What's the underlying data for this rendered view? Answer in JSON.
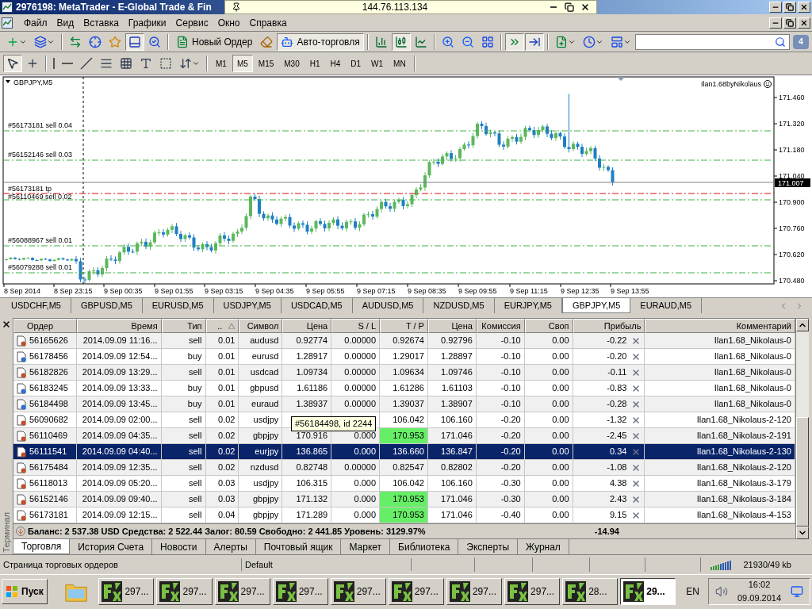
{
  "window": {
    "title": "2976198: MetaTrader - E-Global Trade & Fin"
  },
  "remote_bar": {
    "address": "144.76.113.134"
  },
  "menu": [
    "Файл",
    "Вид",
    "Вставка",
    "Графики",
    "Сервис",
    "Окно",
    "Справка"
  ],
  "toolbar": {
    "items": [
      {
        "kind": "new-chart",
        "pressed": false
      },
      {
        "kind": "profiles",
        "pressed": false
      },
      {
        "kind": "separator"
      },
      {
        "kind": "market-watch",
        "pressed": false
      },
      {
        "kind": "navigator",
        "pressed": false
      },
      {
        "kind": "favorites",
        "pressed": false
      },
      {
        "kind": "terminal",
        "pressed": true
      },
      {
        "kind": "tester",
        "pressed": false
      },
      {
        "kind": "separator"
      },
      {
        "kind": "order",
        "label": "Новый Ордер",
        "pressed": false
      },
      {
        "kind": "editor",
        "pressed": false
      },
      {
        "kind": "autotrading",
        "label": "Авто-торговля",
        "pressed": true
      },
      {
        "kind": "separator"
      },
      {
        "kind": "bar-chart",
        "pressed": false
      },
      {
        "kind": "candles",
        "pressed": true
      },
      {
        "kind": "line-chart",
        "pressed": false
      },
      {
        "kind": "separator"
      },
      {
        "kind": "zoom-in",
        "pressed": false
      },
      {
        "kind": "zoom-out",
        "pressed": false
      },
      {
        "kind": "tile",
        "pressed": false
      },
      {
        "kind": "separator"
      },
      {
        "kind": "autoscroll",
        "pressed": true
      },
      {
        "kind": "chart-shift",
        "pressed": true
      },
      {
        "kind": "separator"
      },
      {
        "kind": "indicators",
        "pressed": false
      },
      {
        "kind": "periods",
        "pressed": false
      },
      {
        "kind": "templates",
        "pressed": false
      }
    ],
    "messages": "4"
  },
  "tools": [
    {
      "kind": "cursor",
      "pressed": true
    },
    {
      "kind": "crosshair",
      "pressed": false
    },
    {
      "kind": "separator"
    },
    {
      "kind": "vline",
      "pressed": false
    },
    {
      "kind": "hline",
      "pressed": false
    },
    {
      "kind": "trend",
      "pressed": false
    },
    {
      "kind": "fibo",
      "pressed": false
    },
    {
      "kind": "gann",
      "pressed": false
    },
    {
      "kind": "text",
      "pressed": false
    },
    {
      "kind": "label",
      "pressed": false
    },
    {
      "kind": "arrows",
      "pressed": false
    }
  ],
  "timeframes": [
    {
      "label": "M1",
      "selected": false
    },
    {
      "label": "M5",
      "selected": true
    },
    {
      "label": "M15",
      "selected": false
    },
    {
      "label": "M30",
      "selected": false
    },
    {
      "label": "H1",
      "selected": false
    },
    {
      "label": "H4",
      "selected": false
    },
    {
      "label": "D1",
      "selected": false
    },
    {
      "label": "W1",
      "selected": false
    },
    {
      "label": "MN",
      "selected": false
    }
  ],
  "chart": {
    "title": "GBPJPY,M5",
    "expert": "Ilan1.68byNikolaus",
    "current_price": "171.007",
    "price_ticks": [
      "171.460",
      "171.320",
      "171.180",
      "171.040",
      "170.900",
      "170.760",
      "170.620",
      "170.480"
    ],
    "time_labels": [
      "8 Sep 2014",
      "8 Sep 23:15",
      "9 Sep 00:35",
      "9 Sep 01:55",
      "9 Sep 03:15",
      "9 Sep 04:35",
      "9 Sep 05:55",
      "9 Sep 07:15",
      "9 Sep 08:35",
      "9 Sep 09:55",
      "9 Sep 11:15",
      "9 Sep 12:35",
      "9 Sep 13:55"
    ],
    "order_lines": [
      {
        "label": "#56173181 sell 0.04",
        "kind": "order"
      },
      {
        "label": "#56152146 sell 0.03",
        "kind": "order"
      },
      {
        "label": "#56173181 tp",
        "kind": "tp"
      },
      {
        "label": "#56110469 sell 0.02",
        "kind": "order"
      },
      {
        "label": "#56088967 sell 0.01",
        "kind": "order"
      },
      {
        "label": "#56079288 sell 0.01",
        "kind": "order"
      }
    ]
  },
  "symbol_tabs": [
    {
      "label": "USDCHF,M5",
      "selected": false
    },
    {
      "label": "GBPUSD,M5",
      "selected": false
    },
    {
      "label": "EURUSD,M5",
      "selected": false
    },
    {
      "label": "USDJPY,M5",
      "selected": false
    },
    {
      "label": "USDCAD,M5",
      "selected": false
    },
    {
      "label": "AUDUSD,M5",
      "selected": false
    },
    {
      "label": "NZDUSD,M5",
      "selected": false
    },
    {
      "label": "EURJPY,M5",
      "selected": false
    },
    {
      "label": "GBPJPY,M5",
      "selected": true
    },
    {
      "label": "EURAUD,M5",
      "selected": false
    }
  ],
  "terminal": {
    "title": "Терминал",
    "columns": [
      "Ордер",
      "Время",
      "Тип",
      "..",
      "Символ",
      "Цена",
      "S / L",
      "T / P",
      "Цена",
      "Комиссия",
      "Своп",
      "Прибыль",
      "Комментарий"
    ],
    "rows": [
      {
        "kind": "sell",
        "selected": false,
        "tp_highlight": false,
        "cells": [
          "56165626",
          "2014.09.09 11:16...",
          "sell",
          "0.01",
          "audusd",
          "0.92774",
          "0.00000",
          "0.92674",
          "0.92796",
          "-0.10",
          "0.00",
          "-0.22",
          "Ilan1.68_Nikolaus-0"
        ]
      },
      {
        "kind": "buy",
        "selected": false,
        "tp_highlight": false,
        "cells": [
          "56178456",
          "2014.09.09 12:54...",
          "buy",
          "0.01",
          "eurusd",
          "1.28917",
          "0.00000",
          "1.29017",
          "1.28897",
          "-0.10",
          "0.00",
          "-0.20",
          "Ilan1.68_Nikolaus-0"
        ]
      },
      {
        "kind": "sell",
        "selected": false,
        "tp_highlight": false,
        "cells": [
          "56182826",
          "2014.09.09 13:29...",
          "sell",
          "0.01",
          "usdcad",
          "1.09734",
          "0.00000",
          "1.09634",
          "1.09746",
          "-0.10",
          "0.00",
          "-0.11",
          "Ilan1.68_Nikolaus-0"
        ]
      },
      {
        "kind": "buy",
        "selected": false,
        "tp_highlight": false,
        "cells": [
          "56183245",
          "2014.09.09 13:33...",
          "buy",
          "0.01",
          "gbpusd",
          "1.61186",
          "0.00000",
          "1.61286",
          "1.61103",
          "-0.10",
          "0.00",
          "-0.83",
          "Ilan1.68_Nikolaus-0"
        ]
      },
      {
        "kind": "buy",
        "selected": false,
        "tp_highlight": false,
        "cells": [
          "56184498",
          "2014.09.09 13:45...",
          "buy",
          "0.01",
          "euraud",
          "1.38937",
          "0.00000",
          "1.39037",
          "1.38907",
          "-0.10",
          "0.00",
          "-0.28",
          "Ilan1.68_Nikolaus-0"
        ]
      },
      {
        "kind": "sell",
        "selected": false,
        "tp_highlight": false,
        "cells": [
          "56090682",
          "2014.09.09 02:00...",
          "sell",
          "0.02",
          "usdjpy",
          null,
          null,
          "106.042",
          "106.160",
          "-0.20",
          "0.00",
          "-1.32",
          "Ilan1.68_Nikolaus-2-120"
        ]
      },
      {
        "kind": "sell",
        "selected": false,
        "tp_highlight": true,
        "cells": [
          "56110469",
          "2014.09.09 04:35...",
          "sell",
          "0.02",
          "gbpjpy",
          "170.916",
          "0.000",
          "170.953",
          "171.046",
          "-0.20",
          "0.00",
          "-2.45",
          "Ilan1.68_Nikolaus-2-191"
        ]
      },
      {
        "kind": "sell",
        "selected": true,
        "tp_highlight": false,
        "cells": [
          "56111541",
          "2014.09.09 04:40...",
          "sell",
          "0.02",
          "eurjpy",
          "136.865",
          "0.000",
          "136.660",
          "136.847",
          "-0.20",
          "0.00",
          "0.34",
          "Ilan1.68_Nikolaus-2-130"
        ]
      },
      {
        "kind": "sell",
        "selected": false,
        "tp_highlight": false,
        "cells": [
          "56175484",
          "2014.09.09 12:35...",
          "sell",
          "0.02",
          "nzdusd",
          "0.82748",
          "0.00000",
          "0.82547",
          "0.82802",
          "-0.20",
          "0.00",
          "-1.08",
          "Ilan1.68_Nikolaus-2-120"
        ]
      },
      {
        "kind": "sell",
        "selected": false,
        "tp_highlight": false,
        "cells": [
          "56118013",
          "2014.09.09 05:20...",
          "sell",
          "0.03",
          "usdjpy",
          "106.315",
          "0.000",
          "106.042",
          "106.160",
          "-0.30",
          "0.00",
          "4.38",
          "Ilan1.68_Nikolaus-3-179"
        ]
      },
      {
        "kind": "sell",
        "selected": false,
        "tp_highlight": true,
        "cells": [
          "56152146",
          "2014.09.09 09:40...",
          "sell",
          "0.03",
          "gbpjpy",
          "171.132",
          "0.000",
          "170.953",
          "171.046",
          "-0.30",
          "0.00",
          "2.43",
          "Ilan1.68_Nikolaus-3-184"
        ]
      },
      {
        "kind": "sell",
        "selected": false,
        "tp_highlight": true,
        "cells": [
          "56173181",
          "2014.09.09 12:15...",
          "sell",
          "0.04",
          "gbpjpy",
          "171.289",
          "0.000",
          "170.953",
          "171.046",
          "-0.40",
          "0.00",
          "9.15",
          "Ilan1.68_Nikolaus-4-153"
        ]
      }
    ],
    "tooltip": "#56184498, id 2244",
    "summary": "Баланс: 2 537.38 USD  Средства: 2 522.44  Залог: 80.59  Свободно: 2 441.85  Уровень: 3129.97%",
    "total": "-14.94",
    "tabs": [
      {
        "label": "Торговля",
        "selected": true
      },
      {
        "label": "История Счета",
        "selected": false
      },
      {
        "label": "Новости",
        "selected": false
      },
      {
        "label": "Алерты",
        "selected": false
      },
      {
        "label": "Почтовый ящик",
        "selected": false
      },
      {
        "label": "Маркет",
        "selected": false
      },
      {
        "label": "Библиотека",
        "selected": false
      },
      {
        "label": "Эксперты",
        "selected": false
      },
      {
        "label": "Журнал",
        "selected": false
      }
    ]
  },
  "status_bar": {
    "hint": "Страница торговых ордеров",
    "profile": "Default",
    "traffic": "21930/49 kb"
  },
  "taskbar": {
    "start": "Пуск",
    "tasks": [
      {
        "label": "297...",
        "selected": false
      },
      {
        "label": "297...",
        "selected": false
      },
      {
        "label": "297...",
        "selected": false
      },
      {
        "label": "297...",
        "selected": false
      },
      {
        "label": "297...",
        "selected": false
      },
      {
        "label": "297...",
        "selected": false
      },
      {
        "label": "297...",
        "selected": false
      },
      {
        "label": "297...",
        "selected": false
      },
      {
        "label": "28...",
        "selected": false
      },
      {
        "label": "29...",
        "selected": true
      }
    ],
    "language": "EN",
    "time": "16:02",
    "date": "09.09.2014"
  }
}
